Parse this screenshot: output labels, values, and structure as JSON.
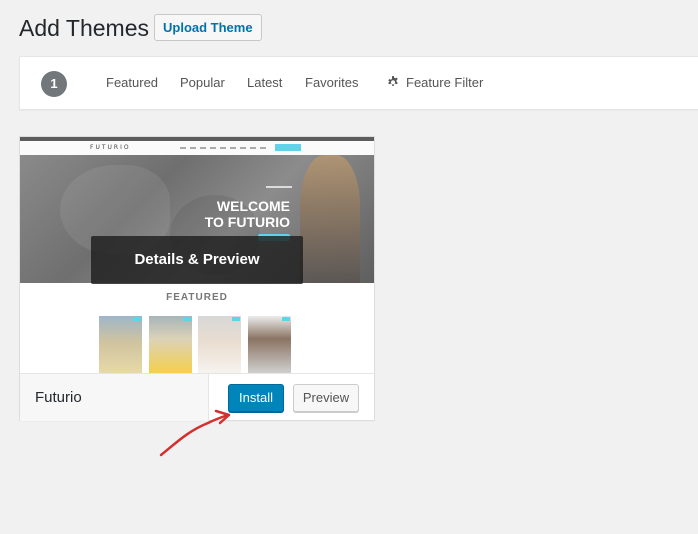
{
  "header": {
    "title": "Add Themes",
    "upload_label": "Upload Theme"
  },
  "filter_bar": {
    "count": "1",
    "links": [
      "Featured",
      "Popular",
      "Latest",
      "Favorites"
    ],
    "feature_filter_label": "Feature Filter",
    "feature_filter_icon": "gear-icon"
  },
  "theme": {
    "name": "Futurio",
    "overlay_label": "Details & Preview",
    "install_label": "Install",
    "preview_label": "Preview",
    "screenshot": {
      "logo": "FUTURIO",
      "hero_title": "WELCOME TO FUTURIO",
      "featured_heading": "FEATURED"
    }
  },
  "colors": {
    "install_bg": "#0085ba",
    "link_blue": "#0073aa",
    "annotation_arrow": "#d32f2f"
  }
}
